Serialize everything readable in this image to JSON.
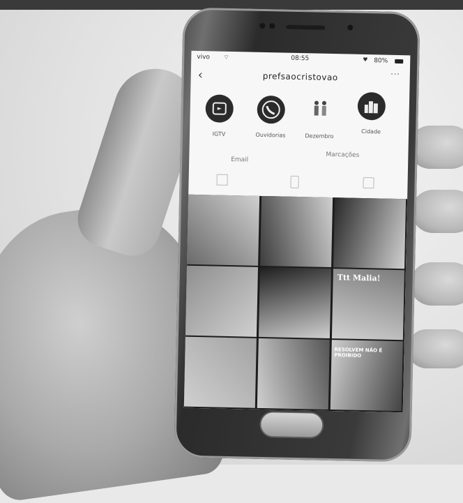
{
  "status_bar": {
    "carrier": "vivo",
    "time": "08:55",
    "battery": "80%",
    "wifi_icon": "wifi-icon",
    "heart_icon": "heart-icon"
  },
  "profile": {
    "username": "prefsaocristovao",
    "back_icon": "back-arrow-icon",
    "more_icon": "more-options-icon"
  },
  "highlights": [
    {
      "label": "IGTV",
      "icon": "igtv-icon"
    },
    {
      "label": "Ouvidorias",
      "icon": "phone-icon"
    },
    {
      "label": "Dezembro",
      "icon": "people-icon"
    },
    {
      "label": "Cidade",
      "icon": "city-icon"
    }
  ],
  "tabs": {
    "posts": "Email",
    "tagged": "Marcações"
  },
  "grid_tiles": [
    {
      "shade": "#6a6a6a"
    },
    {
      "shade": "#3d3d3d"
    },
    {
      "shade": "#2a2a2a"
    },
    {
      "shade": "#8f8f8f"
    },
    {
      "shade": "#1e1e1e"
    },
    {
      "shade": "#7d7d7d"
    },
    {
      "shade": "#a3a3a3"
    },
    {
      "shade": "#555555"
    },
    {
      "shade": "#444444"
    }
  ],
  "grid_captions": {
    "tile_6": "Ttt Malia!",
    "tile_9": "RESOLVEM NÃO É PROIBIDO"
  }
}
